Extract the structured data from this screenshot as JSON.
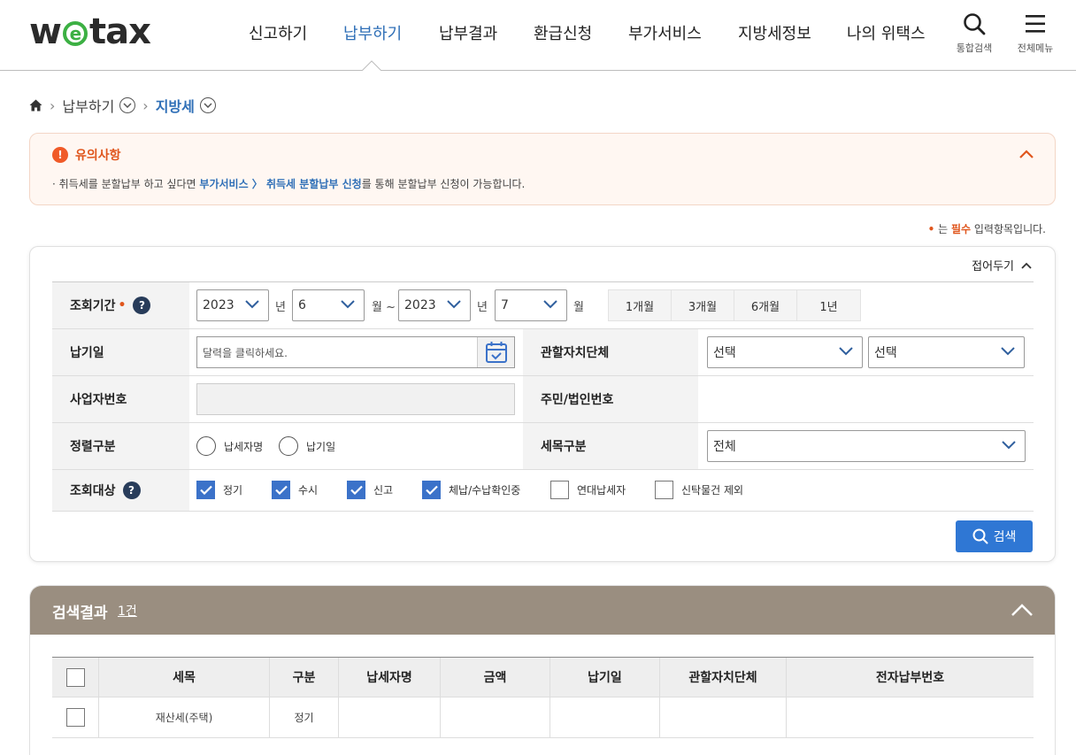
{
  "header": {
    "logo_pre": "w",
    "logo_e": "e",
    "logo_post": "tax",
    "nav": [
      {
        "label": "신고하기"
      },
      {
        "label": "납부하기"
      },
      {
        "label": "납부결과"
      },
      {
        "label": "환급신청"
      },
      {
        "label": "부가서비스"
      },
      {
        "label": "지방세정보"
      },
      {
        "label": "나의 위택스"
      }
    ],
    "search_label": "통합검색",
    "menu_label": "전체메뉴"
  },
  "breadcrumb": {
    "level1": "납부하기",
    "level2": "지방세"
  },
  "notice": {
    "title": "유의사항",
    "text_pre": "· 취득세를 분할납부 하고 싶다면 ",
    "text_link": "부가서비스 〉 취득세 분할납부 신청",
    "text_post": "를 통해 분할납부 신청이 가능합니다."
  },
  "required_note": {
    "dot": "•",
    "pre": " 는 ",
    "req": "필수",
    "post": " 입력항목입니다."
  },
  "search": {
    "fold_label": "접어두기",
    "period_label": "조회기간",
    "period_dot": "•",
    "q": "?",
    "start_year": "2023",
    "start_month": "6",
    "end_year": "2023",
    "end_month": "7",
    "unit_year": "년",
    "unit_month_tilde": "월 ~",
    "unit_month": "월",
    "period_buttons": [
      "1개월",
      "3개월",
      "6개월",
      "1년"
    ],
    "due_date_label": "납기일",
    "due_date_placeholder": "달력을 클릭하세요.",
    "local_gov_label": "관할자치단체",
    "local_gov_select1": "선택",
    "local_gov_select2": "선택",
    "biz_no_label": "사업자번호",
    "resident_no_label": "주민/법인번호",
    "sort_label": "정렬구분",
    "sort_options": [
      "납세자명",
      "납기일"
    ],
    "tax_item_label": "세목구분",
    "tax_item_value": "전체",
    "target_label": "조회대상",
    "targets": [
      {
        "label": "정기",
        "checked": true
      },
      {
        "label": "수시",
        "checked": true
      },
      {
        "label": "신고",
        "checked": true
      },
      {
        "label": "체납/수납확인중",
        "checked": true
      },
      {
        "label": "연대납세자",
        "checked": false
      },
      {
        "label": "신탁물건 제외",
        "checked": false
      }
    ],
    "search_button": "검색"
  },
  "results": {
    "title": "검색결과",
    "count": "1건",
    "columns": [
      "세목",
      "구분",
      "납세자명",
      "금액",
      "납기일",
      "관할자치단체",
      "전자납부번호"
    ],
    "rows": [
      {
        "tax_item": "재산세(주택)",
        "type": "정기"
      }
    ]
  },
  "colors": {
    "accent_blue": "#2f6fb7",
    "button_blue": "#2f77d4",
    "notice_orange": "#e0561d",
    "results_header": "#9a8e80"
  }
}
